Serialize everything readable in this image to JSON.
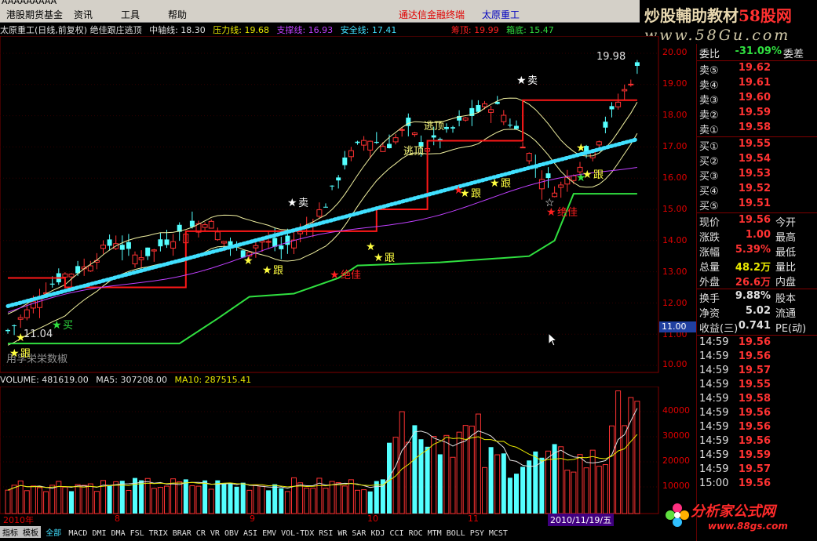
{
  "window": {
    "title": "AAAAAAAAA"
  },
  "menu": {
    "items": [
      "港股期货基金",
      "资讯",
      "工具",
      "帮助"
    ],
    "promo": "通达信金融终端",
    "stock": "太原重工"
  },
  "brand": {
    "line1a": "炒股輔助教材",
    "line1b": "58股网",
    "line2": "www.58Gu.com"
  },
  "indicator": {
    "header": "太原重工(日线,前复权) 绝佳跟庄逃顶",
    "mid": "中轴线: 18.30",
    "press": "压力线: 19.68",
    "support": "支撑线: 16.93",
    "safe": "安全线: 17.41",
    "top": "筹顶: 19.99",
    "bottom": "箱底: 15.47"
  },
  "price_axis": [
    "20.00",
    "19.00",
    "18.00",
    "17.00",
    "16.00",
    "15.00",
    "14.00",
    "13.00",
    "12.00",
    "11.00",
    "10.00"
  ],
  "axis_marker": "11.00",
  "annotations": {
    "high": "19.98",
    "low": "11.04",
    "sell": "卖",
    "follow": "跟",
    "escape": "逃顶",
    "buy": "买",
    "best_buy": "绝佳",
    "watermark_text": "用孚栄栄数椒"
  },
  "volume": {
    "header": "VOLUME: 481619.00",
    "ma5": "MA5: 307208.00",
    "ma10": "MA10: 287515.41",
    "axis": [
      "40000",
      "30000",
      "20000",
      "10000"
    ]
  },
  "dates": {
    "d1": "2010年",
    "m8": "8",
    "m9": "9",
    "m10": "10",
    "m11": "11",
    "current": "2010/11/19/五"
  },
  "tabs": {
    "left": [
      "指标",
      "模板"
    ],
    "all": "全部",
    "items": [
      "MACD",
      "DMI",
      "DMA",
      "FSL",
      "TRIX",
      "BRAR",
      "CR",
      "VR",
      "OBV",
      "ASI",
      "EMV",
      "VOL-TDX",
      "RSI",
      "WR",
      "SAR",
      "KDJ",
      "CCI",
      "ROC",
      "MTM",
      "BOLL",
      "PSY",
      "MCST"
    ]
  },
  "quote": {
    "ratio": {
      "label": "委比",
      "value": "-31.09%",
      "label2": "委差"
    },
    "asks": [
      {
        "label": "卖⑤",
        "value": "19.62"
      },
      {
        "label": "卖④",
        "value": "19.61"
      },
      {
        "label": "卖③",
        "value": "19.60"
      },
      {
        "label": "卖②",
        "value": "19.59"
      },
      {
        "label": "卖①",
        "value": "19.58"
      }
    ],
    "bids": [
      {
        "label": "买①",
        "value": "19.55"
      },
      {
        "label": "买②",
        "value": "19.54"
      },
      {
        "label": "买③",
        "value": "19.53"
      },
      {
        "label": "买④",
        "value": "19.52"
      },
      {
        "label": "买⑤",
        "value": "19.51"
      }
    ],
    "stats": [
      {
        "label": "现价",
        "value": "19.56",
        "label2": "今开"
      },
      {
        "label": "涨跌",
        "value": "1.00",
        "label2": "最高"
      },
      {
        "label": "涨幅",
        "value": "5.39%",
        "label2": "最低"
      },
      {
        "label": "总量",
        "value": "48.2万",
        "label2": "量比"
      },
      {
        "label": "外盘",
        "value": "26.6万",
        "label2": "内盘"
      }
    ],
    "stats2": [
      {
        "label": "换手",
        "value": "9.88%",
        "label2": "股本"
      },
      {
        "label": "净资",
        "value": "5.02",
        "label2": "流通"
      },
      {
        "label": "收益(三)",
        "value": "0.741",
        "label2": "PE(动)"
      }
    ],
    "ticks": [
      {
        "time": "14:59",
        "price": "19.56"
      },
      {
        "time": "14:59",
        "price": "19.56"
      },
      {
        "time": "14:59",
        "price": "19.57"
      },
      {
        "time": "14:59",
        "price": "19.55"
      },
      {
        "time": "14:59",
        "price": "19.58"
      },
      {
        "time": "14:59",
        "price": "19.56"
      },
      {
        "time": "14:59",
        "price": "19.56"
      },
      {
        "time": "14:59",
        "price": "19.56"
      },
      {
        "time": "14:59",
        "price": "19.59"
      },
      {
        "time": "14:59",
        "price": "19.57"
      },
      {
        "time": "15:00",
        "price": "19.56"
      }
    ]
  },
  "watermark": {
    "site": "分析家公式网",
    "url": "www.88gs.com"
  },
  "colors": {
    "up": "#ff3232",
    "down": "#54ffff",
    "mid": "#e8e8a0",
    "press": "#ff2020",
    "support": "#c040ff",
    "safe": "#30e040"
  }
}
